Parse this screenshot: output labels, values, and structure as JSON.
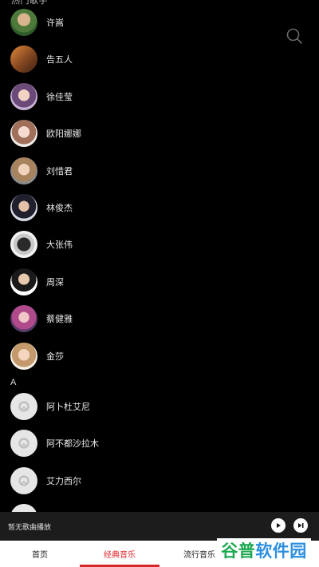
{
  "header": {
    "partial_label": "热门歌手"
  },
  "search": {
    "icon": "search-icon"
  },
  "artists": [
    {
      "name": "许嵩"
    },
    {
      "name": "告五人"
    },
    {
      "name": "徐佳莹"
    },
    {
      "name": "欧阳娜娜"
    },
    {
      "name": "刘惜君"
    },
    {
      "name": "林俊杰"
    },
    {
      "name": "大张伟"
    },
    {
      "name": "周深"
    },
    {
      "name": "蔡健雅"
    },
    {
      "name": "金莎"
    }
  ],
  "section_a": {
    "letter": "A",
    "artists": [
      {
        "name": "阿卜杜艾尼"
      },
      {
        "name": "阿不都沙拉木"
      },
      {
        "name": "艾力西尔"
      }
    ]
  },
  "player": {
    "status_text": "暂无歌曲播放",
    "play_icon": "play-icon",
    "next_icon": "next-icon"
  },
  "tabs": [
    {
      "label": "首页"
    },
    {
      "label": "经典音乐"
    },
    {
      "label": "流行音乐"
    }
  ],
  "watermark": {
    "text_a": "谷普",
    "text_b": "软件园"
  },
  "colors": {
    "background": "#000000",
    "accent": "#e0242c",
    "player_bg": "#1c1c1c",
    "watermark_green": "#1aa84e",
    "watermark_blue": "#2d8fe0"
  }
}
